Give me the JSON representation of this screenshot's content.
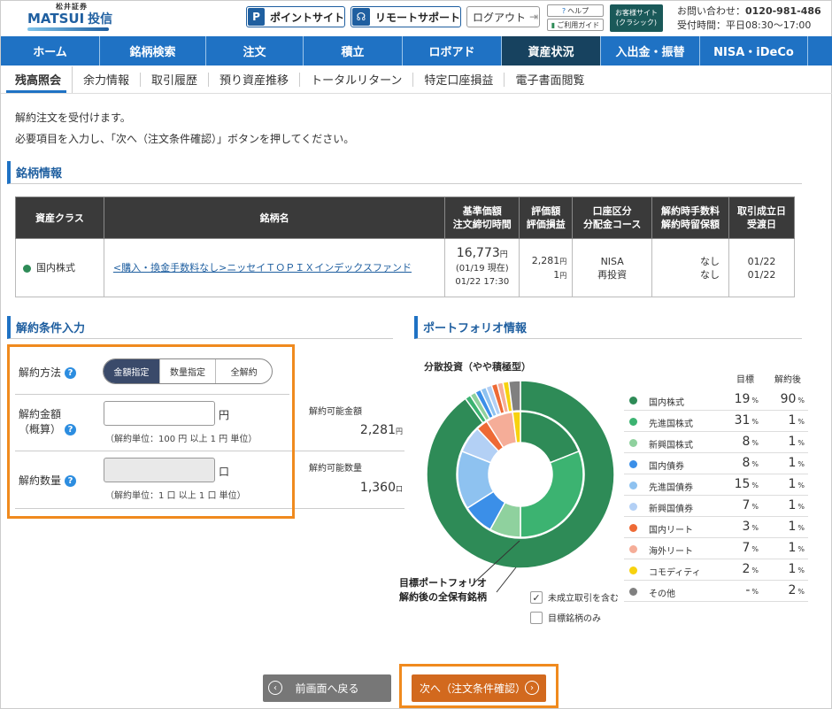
{
  "header": {
    "brand_small": "松井証券",
    "brand_main": "MATSUI",
    "brand_sub": "投信",
    "point_site": "ポイントサイト",
    "remote_support": "リモートサポート",
    "logout": "ログアウト",
    "help": "ヘルプ",
    "guide": "ご利用ガイド",
    "classic_line1": "お客様サイト",
    "classic_line2": "(クラシック)",
    "contact_label": "お問い合わせ：",
    "contact_phone": "0120-981-486",
    "hours": "受付時間：平日08:30～17:00"
  },
  "nav": [
    "ホーム",
    "銘柄検索",
    "注文",
    "積立",
    "ロボアド",
    "資産状況",
    "入出金・振替",
    "NISA・iDeCo"
  ],
  "subnav": [
    "残高照会",
    "余力情報",
    "取引履歴",
    "預り資産推移",
    "トータルリターン",
    "特定口座損益",
    "電子書面閲覧"
  ],
  "messages": {
    "line1": "解約注文を受付けます。",
    "line2": "必要項目を入力し、「次へ（注文条件確認）」ボタンを押してください。"
  },
  "fund_section": {
    "title": "銘柄情報",
    "headers": {
      "asset_class": "資産クラス",
      "name": "銘柄名",
      "base_price_1": "基準価額",
      "base_price_2": "注文締切時間",
      "valuation_1": "評価額",
      "valuation_2": "評価損益",
      "account_1": "口座区分",
      "account_2": "分配金コース",
      "fee_1": "解約時手数料",
      "fee_2": "解約時留保額",
      "date_1": "取引成立日",
      "date_2": "受渡日"
    },
    "row": {
      "asset_class": "国内株式",
      "name": "<購入・換金手数料なし>ニッセイＴＯＰＩＸインデックスファンド",
      "price": "16,773",
      "price_unit": "円",
      "price_date": "(01/19 現在)",
      "deadline": "01/22 17:30",
      "valuation": "2,281",
      "valuation_unit": "円",
      "pl": "1",
      "pl_unit": "円",
      "account": "NISA",
      "course": "再投資",
      "fee": "なし",
      "reserve": "なし",
      "trade_date": "01/22",
      "settle_date": "01/22"
    }
  },
  "form": {
    "title": "解約条件入力",
    "method_label": "解約方法",
    "methods": [
      "金額指定",
      "数量指定",
      "全解約"
    ],
    "amount_label_1": "解約金額",
    "amount_label_2": "（概算）",
    "amount_unit": "円",
    "amount_hint": "（解約単位：100 円 以上 1 円 単位）",
    "qty_label": "解約数量",
    "qty_unit": "口",
    "qty_hint": "（解約単位：1 口 以上 1 口 単位）",
    "available_amount_label": "解約可能金額",
    "available_amount": "2,281",
    "available_amount_unit": "円",
    "available_qty_label": "解約可能数量",
    "available_qty": "1,360",
    "available_qty_unit": "口",
    "q": "?"
  },
  "portfolio": {
    "title": "ポートフォリオ情報",
    "subtitle": "分散投資（やや積極型）",
    "col_target": "目標",
    "col_after": "解約後",
    "label_line1": "目標ポートフォリオ",
    "label_line2": "解約後の全保有銘柄",
    "check1": "未成立取引を含む",
    "check2": "目標銘柄のみ",
    "check_mark": "✓",
    "pct": "%",
    "colors": [
      "#2e8b57",
      "#3cb371",
      "#8fd19e",
      "#3b8fe8",
      "#8ec2f0",
      "#b3d0f5",
      "#ee6a35",
      "#f5ad98",
      "#f7d20f",
      "#808080"
    ],
    "items": [
      {
        "name": "国内株式",
        "target": "19",
        "after": "90"
      },
      {
        "name": "先進国株式",
        "target": "31",
        "after": "1"
      },
      {
        "name": "新興国株式",
        "target": "8",
        "after": "1"
      },
      {
        "name": "国内債券",
        "target": "8",
        "after": "1"
      },
      {
        "name": "先進国債券",
        "target": "15",
        "after": "1"
      },
      {
        "name": "新興国債券",
        "target": "7",
        "after": "1"
      },
      {
        "name": "国内リート",
        "target": "3",
        "after": "1"
      },
      {
        "name": "海外リート",
        "target": "7",
        "after": "1"
      },
      {
        "name": "コモディティ",
        "target": "2",
        "after": "1"
      },
      {
        "name": "その他",
        "target": "-",
        "after": "2"
      }
    ],
    "target_values": [
      19,
      31,
      8,
      8,
      15,
      7,
      3,
      7,
      2,
      0
    ],
    "after_values": [
      90,
      1,
      1,
      1,
      1,
      1,
      1,
      1,
      1,
      2
    ]
  },
  "buttons": {
    "back": "前画面へ戻る",
    "next": "次へ（注文条件確認）",
    "back_arrow": "‹",
    "next_arrow": "›"
  }
}
